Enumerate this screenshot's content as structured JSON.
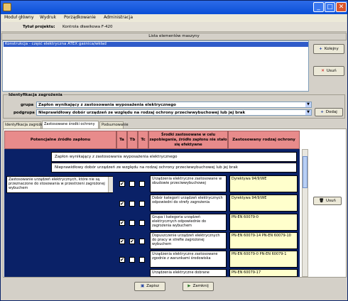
{
  "window": {
    "minimize": "_",
    "maximize": "□",
    "close": "✕"
  },
  "menu": [
    "Moduł główny",
    "Wydruk",
    "Porządkowanie",
    "Administracja"
  ],
  "project": {
    "label": "Tytuł projektu:",
    "value": "Kontrola dławikowa F-420"
  },
  "elements_header": "Lista elementów maszyny",
  "elements": [
    "Konstrukcja - część elektryczna ATEX gaśnica/wkład"
  ],
  "buttons": {
    "add": "Kolejny",
    "delete": "Usuń",
    "add2": "Dodaj",
    "delete2": "Usuń",
    "save": "Zapisz",
    "close": "Zamknij"
  },
  "identification": {
    "group_label": "Identyfikacja zagrożenia",
    "group_field_label": "grupa",
    "group_value": "Zapłon wynikający z zastosowania wyposażenia elektrycznego",
    "subgroup_label": "podgrupa",
    "subgroup_value": "Nieprawidłowy dobór urządzeń ze względu na rodzaj ochrony przeciwwybuchowej lub jej brak"
  },
  "tabs": [
    "Identyfikacja zagrożenia",
    "Zastosowane środki ochrony",
    "Podsumowanie"
  ],
  "table": {
    "headers": [
      "Potencjalne źródło zapłonu",
      "Ta",
      "Tb",
      "Tc",
      "Środki zastosowane w celu zapobiegania, źródło zapłonu nie stało się efektywne",
      "Zastosowany rodzaj ochrony"
    ],
    "band1": "Zapłon wynikający z zastosowania wyposażenia elektrycznego",
    "band2": "Nieprawidłowy dobór urządzeń ze względu na rodzaj ochrony przeciwwybuchowej lub jej brak",
    "source": "Zastosowanie urządzeń elektrycznych, które nie są przeznaczone do stosowania w przestrzeni zagrożonej wybuchem",
    "rows": [
      {
        "ta": "✔",
        "tb": "",
        "tc": "",
        "measure": "Urządzenia elektryczne zastosowane w obudowie przeciwwybuchowej",
        "protection": "Dyrektywa 94/9/WE"
      },
      {
        "ta": "✔",
        "tb": "",
        "tc": "",
        "measure": "Dobór kategorii urządzeń elektrycznych odpowiedni do strefy zagrożenia",
        "protection": "Dyrektywa 94/9/WE"
      },
      {
        "ta": "✔",
        "tb": "",
        "tc": "",
        "measure": "Grupa i kategoria urządzeń elektrycznych odpowiednie do zagrożenia wybuchem",
        "protection": "PN-EN 60079-0"
      },
      {
        "ta": "✔",
        "tb": "✔",
        "tc": "",
        "measure": "Dopuszczenie urządzeń elektrycznych do pracy w strefie zagrożonej wybuchem",
        "protection": "PN-EN 60079-14 PN-EN 60079-10"
      },
      {
        "ta": "✔",
        "tb": "",
        "tc": "",
        "measure": "Urządzenia elektryczne zastosowane zgodnie z warunkami środowiska",
        "protection": "PN-EN 60079-0 PN-EN 60079-1"
      },
      {
        "ta": "",
        "tb": "",
        "tc": "",
        "measure": "Urządzenia elektryczne dobrane",
        "protection": "PN-EN 60079-17"
      }
    ]
  },
  "colors": {
    "title_bar": "#0a4fd6",
    "header_red": "#e88b8b",
    "navy": "#0a2167",
    "measure_bg": "#ffffff",
    "protection_bg": "#ffffcc"
  }
}
